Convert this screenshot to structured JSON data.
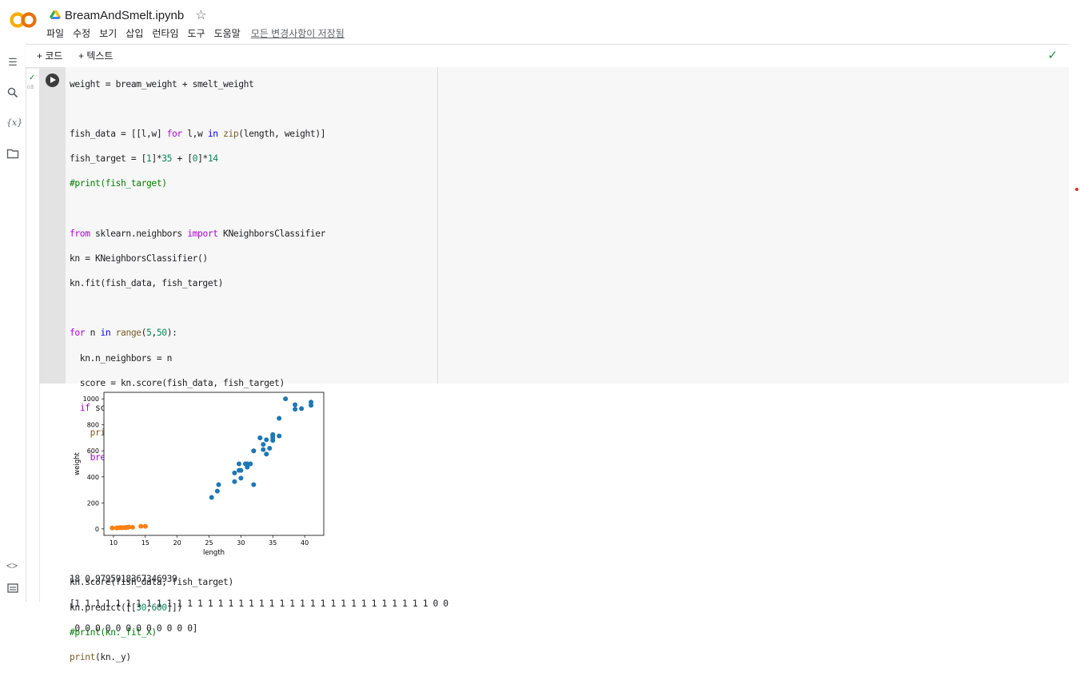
{
  "app": {
    "title": "BreamAndSmelt.ipynb",
    "menu": [
      "파일",
      "수정",
      "보기",
      "삽입",
      "런타임",
      "도구",
      "도움말"
    ],
    "saved_status": "모든 변경사항이 저장됨"
  },
  "toolbar": {
    "add_code": "+ 코드",
    "add_text": "+ 텍스트"
  },
  "cell": {
    "exec_time": "0초",
    "code_lines": [
      "weight = bream_weight + smelt_weight",
      "",
      "fish_data = [[l,w] for l,w in zip(length, weight)]",
      "fish_target = [1]*35 + [0]*14",
      "#print(fish_target)",
      "",
      "from sklearn.neighbors import KNeighborsClassifier",
      "kn = KNeighborsClassifier()",
      "kn.fit(fish_data, fish_target)",
      "",
      "for n in range(5,50):",
      "  kn.n_neighbors = n",
      "  score = kn.score(fish_data, fish_target)",
      "  if score < 1:",
      "    print(n,score)",
      "    break",
      "",
      "",
      "",
      "",
      "kn.score(fish_data, fish_target)",
      "kn.predict([[30,600]])",
      "#print(kn._fit_X)",
      "print(kn._y)"
    ]
  },
  "output": {
    "stdout_lines": [
      "18 0.9795918367346939",
      "[1 1 1 1 1 1 1 1 1 1 1 1 1 1 1 1 1 1 1 1 1 1 1 1 1 1 1 1 1 1 1 1 1 1 1 0 0",
      " 0 0 0 0 0 0 0 0 0 0 0 0]"
    ]
  },
  "chart_data": {
    "type": "scatter",
    "xlabel": "length",
    "ylabel": "weight",
    "xlim": [
      8.5,
      43
    ],
    "ylim": [
      -50,
      1050
    ],
    "xticks": [
      10,
      15,
      20,
      25,
      30,
      35,
      40
    ],
    "yticks": [
      0,
      200,
      400,
      600,
      800,
      1000
    ],
    "series": [
      {
        "color": "#1f77b4",
        "points": [
          [
            25.4,
            242
          ],
          [
            26.3,
            290
          ],
          [
            26.5,
            340
          ],
          [
            29.0,
            363
          ],
          [
            29.0,
            430
          ],
          [
            29.7,
            450
          ],
          [
            29.7,
            500
          ],
          [
            30.0,
            390
          ],
          [
            30.0,
            450
          ],
          [
            30.7,
            500
          ],
          [
            31.0,
            475
          ],
          [
            31.0,
            500
          ],
          [
            31.5,
            500
          ],
          [
            32.0,
            340
          ],
          [
            32.0,
            600
          ],
          [
            32.0,
            600
          ],
          [
            33.0,
            700
          ],
          [
            33.0,
            700
          ],
          [
            33.5,
            610
          ],
          [
            33.5,
            650
          ],
          [
            34.0,
            575
          ],
          [
            34.0,
            685
          ],
          [
            34.5,
            620
          ],
          [
            35.0,
            680
          ],
          [
            35.0,
            700
          ],
          [
            35.0,
            725
          ],
          [
            35.0,
            720
          ],
          [
            36.0,
            714
          ],
          [
            36.0,
            850
          ],
          [
            37.0,
            1000
          ],
          [
            38.5,
            920
          ],
          [
            38.5,
            955
          ],
          [
            39.5,
            925
          ],
          [
            41.0,
            975
          ],
          [
            41.0,
            950
          ]
        ]
      },
      {
        "color": "#ff7f0e",
        "points": [
          [
            9.8,
            6.7
          ],
          [
            10.5,
            7.5
          ],
          [
            10.6,
            7.0
          ],
          [
            11.0,
            9.7
          ],
          [
            11.2,
            9.8
          ],
          [
            11.3,
            8.7
          ],
          [
            11.8,
            10.0
          ],
          [
            11.8,
            9.9
          ],
          [
            12.0,
            9.8
          ],
          [
            12.2,
            12.2
          ],
          [
            12.4,
            13.4
          ],
          [
            13.0,
            12.2
          ],
          [
            14.3,
            19.7
          ],
          [
            15.0,
            19.9
          ]
        ]
      }
    ]
  }
}
